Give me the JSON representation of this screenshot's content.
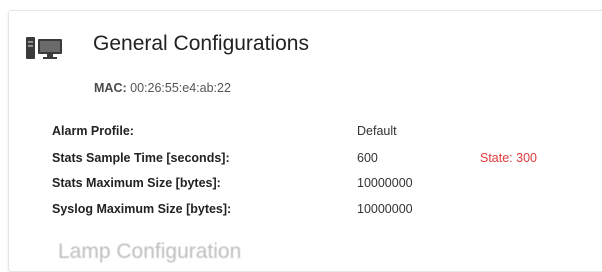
{
  "section": {
    "title": "General Configurations",
    "icon": "computer-icon",
    "mac_label": "MAC:",
    "mac_value": "00:26:55:e4:ab:22"
  },
  "config": {
    "rows": [
      {
        "key": "Alarm Profile:",
        "value": "Default",
        "state": ""
      },
      {
        "key": "Stats Sample Time [seconds]:",
        "value": "600",
        "state": "State: 300"
      },
      {
        "key": "Stats Maximum Size [bytes]:",
        "value": "10000000",
        "state": ""
      },
      {
        "key": "Syslog Maximum Size [bytes]:",
        "value": "10000000",
        "state": ""
      }
    ]
  },
  "next_section": {
    "title": "Lamp Configuration"
  },
  "colors": {
    "state_text": "#e23a3a",
    "icon": "#3b3b3b"
  }
}
